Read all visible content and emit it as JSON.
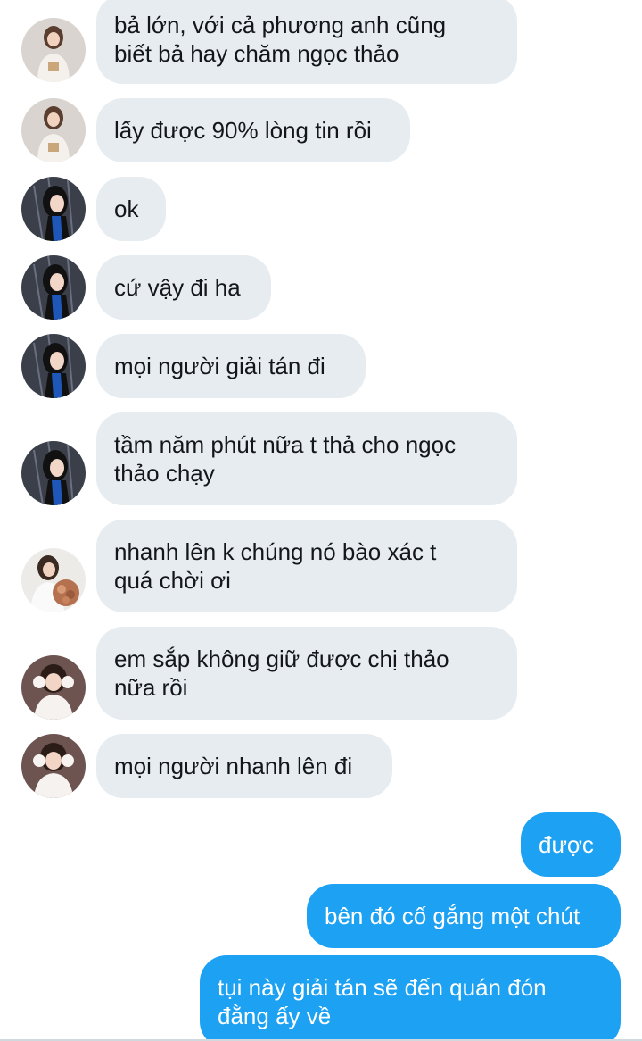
{
  "colors": {
    "incoming_bubble": "#e6ecf0",
    "outgoing_bubble": "#1da1f2",
    "incoming_text": "#14171a",
    "outgoing_text": "#ffffff"
  },
  "messages": [
    {
      "direction": "incoming",
      "sender_avatar": "avatar-white-sweater-girl",
      "text": "bả lớn, với cả phương anh cũng\nbiết bả hay chăm ngọc thảo"
    },
    {
      "direction": "incoming",
      "sender_avatar": "avatar-white-sweater-girl",
      "text": "lấy được 90% lòng tin rồi"
    },
    {
      "direction": "incoming",
      "sender_avatar": "avatar-dark-hair-girl",
      "text": "ok"
    },
    {
      "direction": "incoming",
      "sender_avatar": "avatar-dark-hair-girl",
      "text": "cứ vậy đi ha"
    },
    {
      "direction": "incoming",
      "sender_avatar": "avatar-dark-hair-girl",
      "text": "mọi người giải tán đi"
    },
    {
      "direction": "incoming",
      "sender_avatar": "avatar-dark-hair-girl",
      "text": "tầm năm phút nữa t thả cho ngọc\nthảo chạy"
    },
    {
      "direction": "incoming",
      "sender_avatar": "avatar-flower-bouquet-girl",
      "text": "nhanh lên k chúng nó bào xác t\nquá chời ơi"
    },
    {
      "direction": "incoming",
      "sender_avatar": "avatar-earmuffs-girl",
      "text": "em sắp không giữ được chị thảo\nnữa rồi"
    },
    {
      "direction": "incoming",
      "sender_avatar": "avatar-earmuffs-girl",
      "text": "mọi người nhanh lên đi"
    },
    {
      "direction": "outgoing",
      "text": "được"
    },
    {
      "direction": "outgoing",
      "text": "bên đó cố gắng một chút"
    },
    {
      "direction": "outgoing",
      "text": "tụi này giải tán sẽ đến quán đón\nđằng ấy về"
    }
  ]
}
